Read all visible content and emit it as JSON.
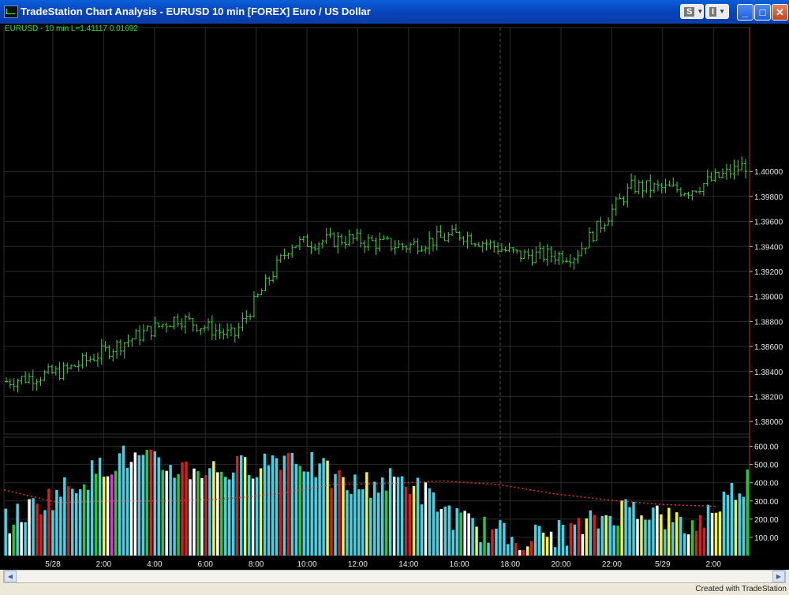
{
  "window": {
    "title": "TradeStation Chart Analysis - EURUSD  10 min  [FOREX] Euro / US Dollar",
    "style_button_letter": "S",
    "indicator_button_letter": "I",
    "minimize_glyph": "_",
    "maximize_glyph": "□",
    "close_glyph": "✕"
  },
  "symbol_label": "EURUSD - 10 min  L=1.41117  0.01692",
  "price_axis_labels": [
    "1.40000",
    "1.39800",
    "1.39600",
    "1.39400",
    "1.39200",
    "1.39000",
    "1.38800",
    "1.38600",
    "1.38400",
    "1.38200",
    "1.38000"
  ],
  "volume_axis_labels": [
    "600.00",
    "500.00",
    "400.00",
    "300.00",
    "200.00",
    "100.00"
  ],
  "time_labels": [
    "5/28",
    "2:00",
    "4:00",
    "6:00",
    "8:00",
    "10:00",
    "12:00",
    "14:00",
    "16:00",
    "18:00",
    "20:00",
    "22:00",
    "5/29",
    "2:00"
  ],
  "scrollbar": {
    "left_arrow": "◀",
    "right_arrow": "▶"
  },
  "footer_credit": "Created with TradeStation",
  "colors": {
    "bars": "#3ed43e",
    "volume_default": "#3ed4e6",
    "volume_up": "#2ec42e",
    "volume_down": "#cc2222",
    "volume_white": "#ffffff",
    "volume_yellow": "#f2f23a",
    "volume_magenta": "#d040d0",
    "moving_average": "#dd3030",
    "grid": "#2a2a2a"
  },
  "chart_data": [
    {
      "type": "ohlc",
      "symbol": "EURUSD",
      "interval": "10 min",
      "last_price": 1.41117,
      "change": 0.01692,
      "ylim": [
        1.379,
        1.4115
      ],
      "x": [
        "5/28",
        "2:00",
        "4:00",
        "6:00",
        "8:00",
        "10:00",
        "12:00",
        "14:00",
        "16:00",
        "18:00",
        "20:00",
        "22:00",
        "5/29",
        "2:00"
      ],
      "close_points": [
        {
          "x": "5/28",
          "y": 1.3832
        },
        {
          "x": "2:00",
          "y": 1.384
        },
        {
          "x": "4:00",
          "y": 1.3862
        },
        {
          "x": "6:00",
          "y": 1.3883
        },
        {
          "x": "8:00",
          "y": 1.3868
        },
        {
          "x": "10:00",
          "y": 1.3942
        },
        {
          "x": "12:00",
          "y": 1.3946
        },
        {
          "x": "14:00",
          "y": 1.394
        },
        {
          "x": "16:00",
          "y": 1.395
        },
        {
          "x": "18:00",
          "y": 1.3933
        },
        {
          "x": "20:00",
          "y": 1.3933
        },
        {
          "x": "22:00",
          "y": 1.3988
        },
        {
          "x": "5/29",
          "y": 1.3985
        },
        {
          "x": "2:00",
          "y": 1.4005
        }
      ]
    },
    {
      "type": "bar",
      "name": "Volume",
      "ylim": [
        0,
        650
      ],
      "categories": [
        "5/28",
        "2:00",
        "4:00",
        "6:00",
        "8:00",
        "10:00",
        "12:00",
        "14:00",
        "16:00",
        "18:00",
        "20:00",
        "22:00",
        "5/29",
        "2:00"
      ],
      "values": [
        180,
        360,
        540,
        480,
        470,
        560,
        380,
        420,
        180,
        90,
        140,
        280,
        150,
        420
      ],
      "moving_average": [
        360,
        290,
        300,
        300,
        310,
        340,
        390,
        395,
        410,
        390,
        340,
        305,
        280,
        270
      ]
    }
  ]
}
